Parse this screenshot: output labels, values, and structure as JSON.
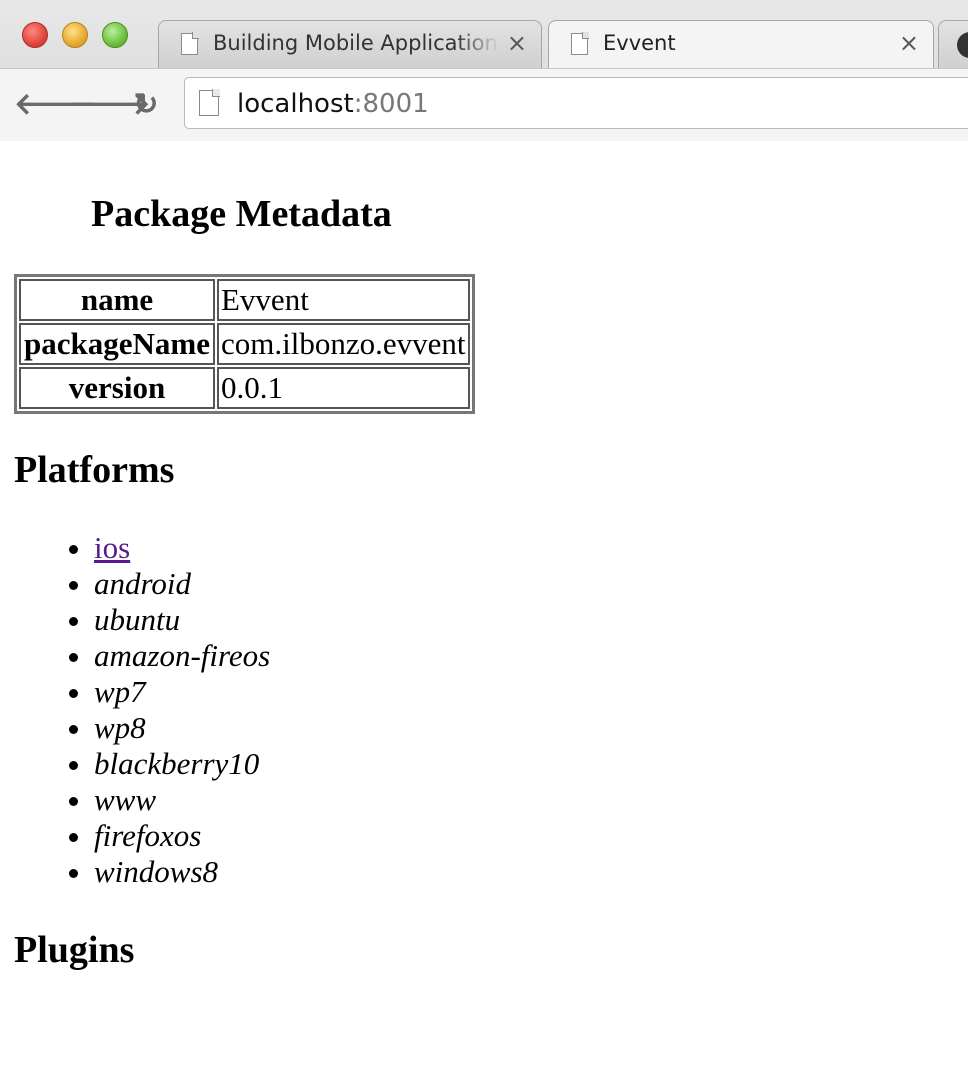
{
  "browser": {
    "tabs": [
      {
        "title": "Building Mobile Application",
        "close": "×"
      },
      {
        "title": "Evvent",
        "close": "×"
      }
    ],
    "nav": {
      "back": "🡐",
      "forward": "🡒",
      "reload": "↻"
    },
    "url": {
      "host": "localhost",
      "port": ":8001"
    }
  },
  "page": {
    "metadata_heading": "Package Metadata",
    "metadata": [
      {
        "key": "name",
        "value": "Evvent"
      },
      {
        "key": "packageName",
        "value": "com.ilbonzo.evvent"
      },
      {
        "key": "version",
        "value": "0.0.1"
      }
    ],
    "platforms_heading": "Platforms",
    "platforms": [
      "ios",
      "android",
      "ubuntu",
      "amazon-fireos",
      "wp7",
      "wp8",
      "blackberry10",
      "www",
      "firefoxos",
      "windows8"
    ],
    "plugins_heading": "Plugins"
  }
}
